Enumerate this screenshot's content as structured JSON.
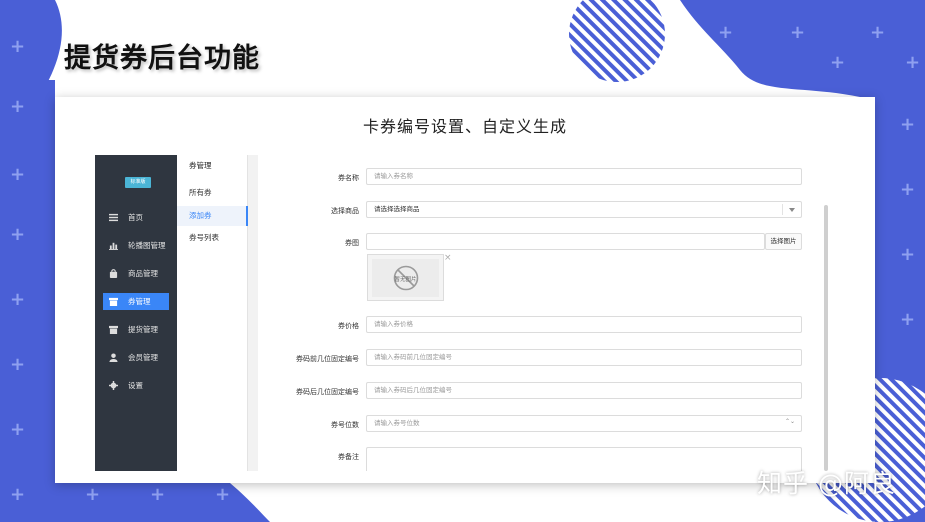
{
  "slide": {
    "title": "提货券后台功能",
    "card_title": "卡券编号设置、自定义生成",
    "watermark": "知乎 @阿良"
  },
  "theme": {
    "accent": "#3a86f7",
    "sidebar_bg": "#2f3640",
    "decor_blue": "#4a5fd6"
  },
  "sidebar": {
    "brand_badge": "标准版",
    "items": [
      {
        "label": "首页",
        "icon": "list-icon"
      },
      {
        "label": "轮播图管理",
        "icon": "chart-icon"
      },
      {
        "label": "商品管理",
        "icon": "bag-icon"
      },
      {
        "label": "券管理",
        "icon": "box-icon",
        "active": true
      },
      {
        "label": "提货管理",
        "icon": "box-icon"
      },
      {
        "label": "会员管理",
        "icon": "user-icon"
      },
      {
        "label": "设置",
        "icon": "gear-icon"
      }
    ]
  },
  "subnav": {
    "title": "券管理",
    "items": [
      {
        "label": "所有券"
      },
      {
        "label": "添加券",
        "active": true
      },
      {
        "label": "券号列表"
      }
    ]
  },
  "form": {
    "name": {
      "label": "券名称",
      "placeholder": "请输入券名称"
    },
    "product": {
      "label": "选择商品",
      "value": "请选择选择商品"
    },
    "image": {
      "label": "券图",
      "button": "选择图片",
      "thumb_text": "暂无图片",
      "close": "×"
    },
    "price": {
      "label": "券价格",
      "placeholder": "请输入券价格"
    },
    "prefix": {
      "label": "券码前几位固定编号",
      "placeholder": "请输入券码前几位固定编号"
    },
    "suffix": {
      "label": "券码后几位固定编号",
      "placeholder": "请输入券码后几位固定编号"
    },
    "digits": {
      "label": "券号位数",
      "placeholder": "请输入券号位数",
      "spinner": "⌃⌄"
    },
    "remark": {
      "label": "券备注"
    }
  }
}
